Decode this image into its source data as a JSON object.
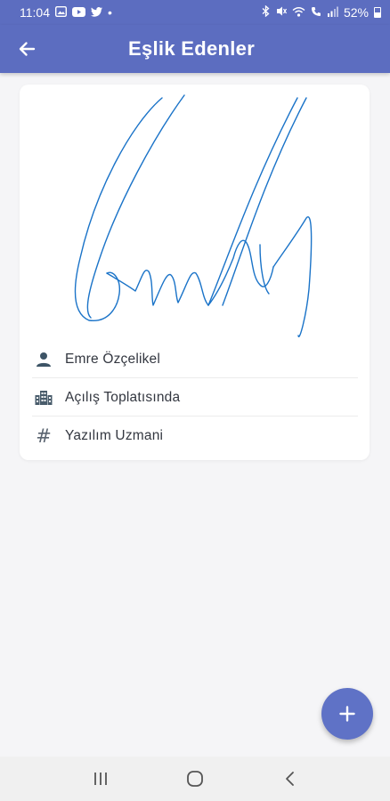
{
  "status_bar": {
    "time": "11:04",
    "dot": "•",
    "battery": "52%",
    "left_icons": [
      "gallery-icon",
      "youtube-icon",
      "twitter-icon"
    ],
    "right_icons": [
      "bluetooth-icon",
      "mute-icon",
      "wifi-icon",
      "call-icon",
      "signal-icon",
      "battery-icon"
    ]
  },
  "app_bar": {
    "title": "Eşlik Edenler",
    "back_icon": "arrow-left-icon",
    "color": "#5c6dc0"
  },
  "attendee": {
    "name": "Emre Özçelikel",
    "meeting": "Açılış Toplatısında",
    "title": "Yazılım Uzmani",
    "name_icon": "person-icon",
    "meeting_icon": "building-icon",
    "title_icon": "hash-icon",
    "hash_glyph": "#",
    "signature_color": "#1a73c8"
  },
  "fab": {
    "icon": "plus-icon",
    "color": "#5f72c6"
  },
  "nav_bar": {
    "icons": [
      "recent-apps-icon",
      "home-icon",
      "back-nav-icon"
    ]
  }
}
